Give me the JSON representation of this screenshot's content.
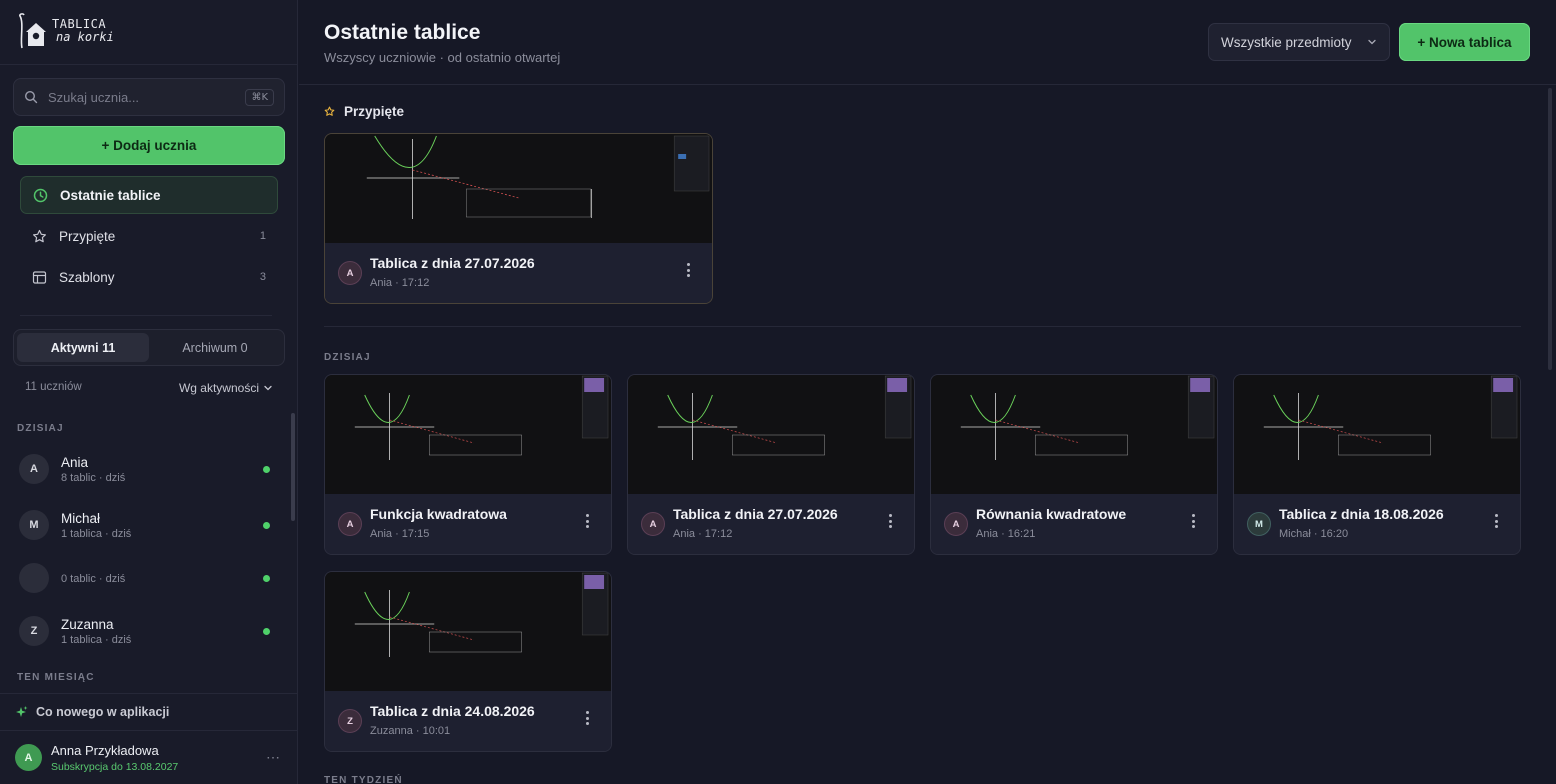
{
  "logo": {
    "line1": "TABLICA",
    "line2": "na korki"
  },
  "search": {
    "placeholder": "Szukaj ucznia...",
    "shortcut": "⌘K"
  },
  "sidebar": {
    "add_student_label": "+ Dodaj ucznia",
    "nav": [
      {
        "label": "Ostatnie tablice",
        "icon": "clock-icon",
        "count": "",
        "active": true
      },
      {
        "label": "Przypięte",
        "icon": "star-icon",
        "count": "1"
      },
      {
        "label": "Szablony",
        "icon": "template-icon",
        "count": "3"
      }
    ],
    "tabs": [
      {
        "label": "Aktywni 11",
        "active": true
      },
      {
        "label": "Archiwum 0",
        "active": false
      }
    ],
    "student_count": "11 uczniów",
    "sort_label": "Wg aktywności",
    "group_today": "DZISIAJ",
    "students": [
      {
        "initial": "A",
        "name": "Ania",
        "sub": "8 tablic · dziś",
        "online": true
      },
      {
        "initial": "M",
        "name": "Michał",
        "sub": "1 tablica · dziś",
        "online": true
      },
      {
        "initial": "",
        "name": "",
        "sub": "0 tablic · dziś",
        "online": true
      },
      {
        "initial": "Z",
        "name": "Zuzanna",
        "sub": "1 tablica · dziś",
        "online": true
      }
    ],
    "group_month": "TEN MIESIĄC",
    "whats_new": "Co nowego w aplikacji",
    "user": {
      "initial": "A",
      "name": "Anna Przykładowa",
      "subscription": "Subskrypcja do 13.08.2027",
      "more": "⋯"
    }
  },
  "header": {
    "title": "Ostatnie tablice",
    "subtitle": "Wszyscy uczniowie · od ostatnio otwartej",
    "subject_select": "Wszystkie przedmioty",
    "new_button": "+ Nowa tablica"
  },
  "pinned": {
    "label": "Przypięte",
    "cards": [
      {
        "initial": "A",
        "title": "Tablica z dnia 27.07.2026",
        "meta": "Ania · 17:12"
      }
    ]
  },
  "today": {
    "label": "DZISIAJ",
    "cards": [
      {
        "initial": "A",
        "title": "Funkcja kwadratowa",
        "meta": "Ania · 17:15"
      },
      {
        "initial": "A",
        "title": "Tablica z dnia 27.07.2026",
        "meta": "Ania · 17:12"
      },
      {
        "initial": "A",
        "title": "Równania kwadratowe",
        "meta": "Ania · 16:21"
      },
      {
        "initial": "M",
        "title": "Tablica z dnia 18.08.2026",
        "meta": "Michał · 16:20"
      },
      {
        "initial": "Z",
        "title": "Tablica z dnia 24.08.2026",
        "meta": "Zuzanna · 10:01"
      }
    ]
  },
  "week_label": "TEN TYDZIEŃ",
  "colors": {
    "accent": "#52c46a",
    "bg": "#161826",
    "sidebar": "#191b29",
    "card": "#1e2030",
    "online": "#4fd16a"
  }
}
